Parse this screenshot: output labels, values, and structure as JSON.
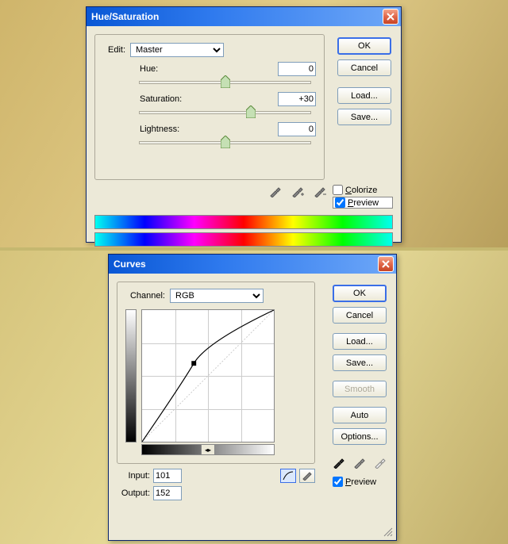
{
  "hueDialog": {
    "title": "Hue/Saturation",
    "editLabel": "Edit:",
    "editValue": "Master",
    "hueLabel": "Hue:",
    "hueValue": "0",
    "satLabel": "Saturation:",
    "satValue": "+30",
    "lightLabel": "Lightness:",
    "lightValue": "0",
    "buttons": {
      "ok": "OK",
      "cancel": "Cancel",
      "load": "Load...",
      "save": "Save..."
    },
    "colorize": {
      "label": "Colorize",
      "checked": false
    },
    "preview": {
      "label": "Preview",
      "checked": true
    }
  },
  "curvesDialog": {
    "title": "Curves",
    "channelLabel": "Channel:",
    "channelValue": "RGB",
    "inputLabel": "Input:",
    "inputValue": "101",
    "outputLabel": "Output:",
    "outputValue": "152",
    "buttons": {
      "ok": "OK",
      "cancel": "Cancel",
      "load": "Load...",
      "save": "Save...",
      "smooth": "Smooth",
      "auto": "Auto",
      "options": "Options..."
    },
    "preview": {
      "label": "Preview",
      "checked": true
    }
  },
  "chart_data": {
    "type": "line",
    "title": "Curves (RGB)",
    "xlabel": "Input",
    "ylabel": "Output",
    "xlim": [
      0,
      255
    ],
    "ylim": [
      0,
      255
    ],
    "x": [
      0,
      50,
      101,
      180,
      255
    ],
    "values": [
      0,
      90,
      152,
      225,
      255
    ],
    "selected_point": {
      "input": 101,
      "output": 152
    }
  }
}
